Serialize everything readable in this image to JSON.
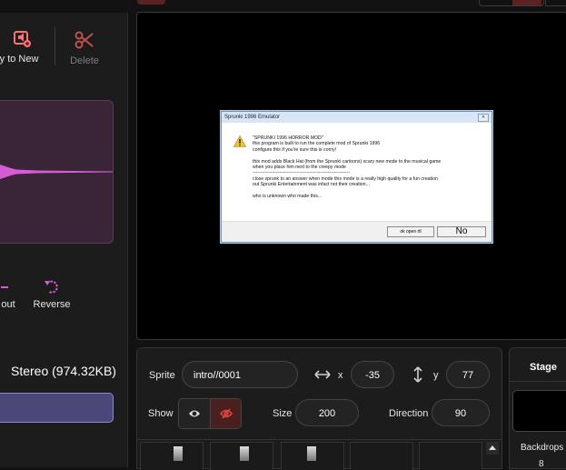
{
  "toolbar": {
    "copy_label": "py to New",
    "delete_label": "Delete"
  },
  "effects": {
    "fade_out_label": "out",
    "reverse_label": "Reverse"
  },
  "sound_info": {
    "format": "Stereo (974.32KB)"
  },
  "dialog": {
    "title": "Sprunki 1996 Emulator",
    "close": "✕",
    "body": "\"SPRUNKI 1996 HORROR MOD\"\nthis program is built to run the complete mod of Sprunki 1996\nconfigure this if you're sure this is corny!\n\nthis mod adds Black Hat (from the Sprunki cartoons) scary new mode to the musical game\nwhen you place him next to the creepy mode\n--------------------------------------------------------------\nclose sprunk to an answer when mode this mode is a really high quality for a fun creation\nout Sprunki Entertainment was infact not their creation...\n\nwho is unknown who made this...",
    "ok_label": "ok open rtl",
    "no_label": "No"
  },
  "sprite": {
    "sprite_label": "Sprite",
    "name": "intro//0001",
    "x_label": "x",
    "x_value": "-35",
    "y_label": "y",
    "y_value": "77",
    "show_label": "Show",
    "size_label": "Size",
    "size_value": "200",
    "direction_label": "Direction",
    "direction_value": "90"
  },
  "stage_panel": {
    "title": "Stage",
    "backdrops_label": "Backdrops",
    "backdrops_count": "8"
  },
  "colors": {
    "accent_red": "#ff6f6f",
    "effect_purple": "#d65cd6",
    "bar_purple": "#4b4778",
    "hide_red": "#e0453f"
  },
  "icons": [
    "copy-to-new-icon",
    "scissors-icon",
    "fade-out-icon",
    "reverse-icon",
    "warning-icon",
    "eye-icon",
    "eye-slash-icon",
    "horizontal-arrows-icon",
    "vertical-arrows-icon",
    "scroll-up-icon"
  ]
}
